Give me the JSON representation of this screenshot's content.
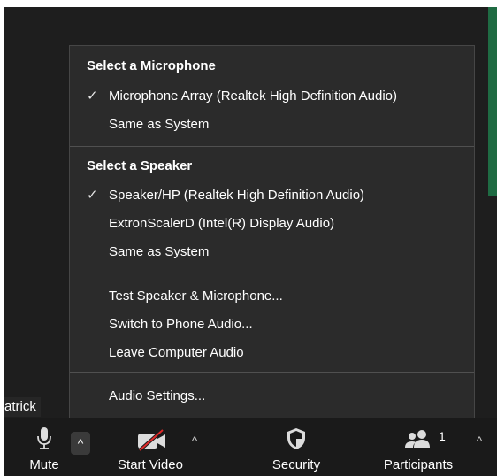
{
  "menu": {
    "microphone_heading": "Select a Microphone",
    "microphones": [
      {
        "label": "Microphone Array (Realtek High Definition Audio)",
        "check": "✓"
      },
      {
        "label": "Same as System",
        "check": ""
      }
    ],
    "speaker_heading": "Select a Speaker",
    "speakers": [
      {
        "label": "Speaker/HP (Realtek High Definition Audio)",
        "check": "✓"
      },
      {
        "label": "ExtronScalerD (Intel(R) Display Audio)",
        "check": ""
      },
      {
        "label": "Same as System",
        "check": ""
      }
    ],
    "actions": [
      {
        "label": "Test Speaker & Microphone..."
      },
      {
        "label": "Switch to Phone Audio..."
      },
      {
        "label": "Leave Computer Audio"
      }
    ],
    "settings": {
      "label": "Audio Settings..."
    }
  },
  "participant_name": "atrick",
  "toolbar": {
    "mute_label": "Mute",
    "start_video_label": "Start Video",
    "security_label": "Security",
    "participants_label": "Participants",
    "participants_count": "1",
    "caret": "^"
  },
  "colors": {
    "menu_bg": "#2b2b2b",
    "toolbar_bg": "#1a1a1a",
    "video_off_red": "#e02828",
    "active_speaker_green": "#1f6b43"
  }
}
